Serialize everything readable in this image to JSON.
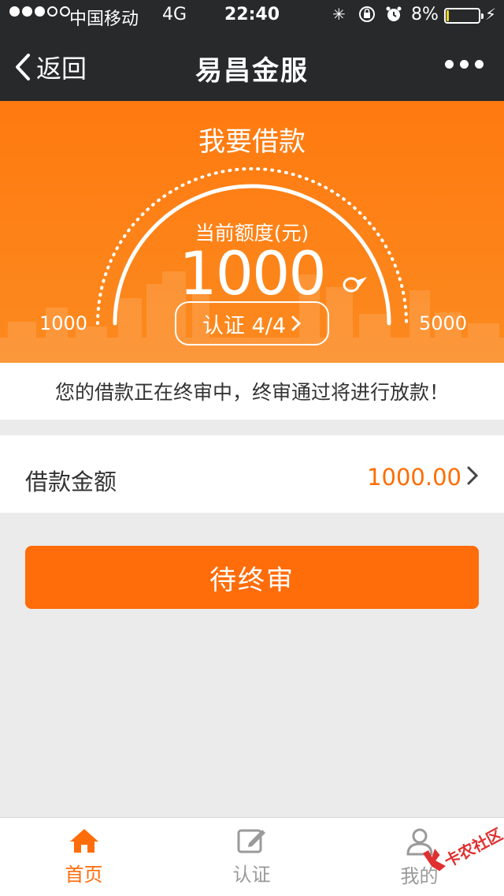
{
  "status_bar": {
    "signal_dots": [
      true,
      true,
      true,
      false,
      false
    ],
    "carrier": "中国移动",
    "network": "4G",
    "time": "22:40",
    "battery_percent": "8%",
    "battery_level": 0.08,
    "battery_color": "#f5d41b"
  },
  "nav": {
    "back_label": "返回",
    "title": "易昌金服",
    "more_icon": "more-icon"
  },
  "hero": {
    "title": "我要借款",
    "quota_label": "当前额度(元)",
    "quota_value": "1000",
    "min_value": "1000",
    "max_value": "5000",
    "auth_button": "认证 4/4",
    "accent_color": "#ff7a10"
  },
  "notice": {
    "text": "您的借款正在终审中，终审通过将进行放款！"
  },
  "loan": {
    "amount_label": "借款金额",
    "amount_value": "1000.00"
  },
  "action": {
    "button_label": "待终审",
    "button_color": "#ff6c0a"
  },
  "tabs": [
    {
      "label": "首页",
      "icon": "home-icon",
      "active": true
    },
    {
      "label": "认证",
      "icon": "edit-icon",
      "active": false
    },
    {
      "label": "我的",
      "icon": "user-icon",
      "active": false
    }
  ],
  "watermark": {
    "text": "卡农社区"
  }
}
